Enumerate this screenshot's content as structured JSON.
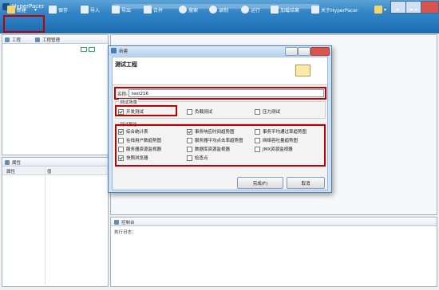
{
  "app": {
    "title": "HyperPacer"
  },
  "toolbar": {
    "new": "新建",
    "save": "保存",
    "import": "导入",
    "export": "导出",
    "merge": "合并",
    "search": "搜索",
    "record": "录制",
    "run": "运行",
    "load_results": "加载结果",
    "about": "关于HyperPacer"
  },
  "left_panel": {
    "tab_project": "工程",
    "tab_project_mgmt": "工程管理"
  },
  "props_panel": {
    "title": "属性",
    "col_property": "属性",
    "col_value": "值"
  },
  "console": {
    "title": "控制台",
    "exec_log": "执行日志："
  },
  "dialog": {
    "window_title": "新建",
    "header": "测试工程",
    "name_label": "名称:",
    "name_value": "test216",
    "scenario_group": "测试场景",
    "scenarios": [
      {
        "label": "开发测试",
        "checked": true
      },
      {
        "label": "负载测试",
        "checked": false
      },
      {
        "label": "压力测试",
        "checked": false
      }
    ],
    "report_group": "测试报告",
    "reports": [
      {
        "label": "综合统计表",
        "checked": true
      },
      {
        "label": "事务响应时间趋势图",
        "checked": true
      },
      {
        "label": "事务平均通过率趋势图",
        "checked": false
      },
      {
        "label": "在线用户数趋势图",
        "checked": false
      },
      {
        "label": "服务器平均点击率趋势图",
        "checked": false
      },
      {
        "label": "网络吞吐量趋势图",
        "checked": false
      },
      {
        "label": "服务器资源监视器",
        "checked": false
      },
      {
        "label": "数据库资源监视器",
        "checked": false
      },
      {
        "label": "JMX资源监视器",
        "checked": false
      },
      {
        "label": "快照浏览器",
        "checked": true
      },
      {
        "label": "检查点",
        "checked": false
      }
    ],
    "finish": "完成(F)",
    "cancel": "取消"
  }
}
